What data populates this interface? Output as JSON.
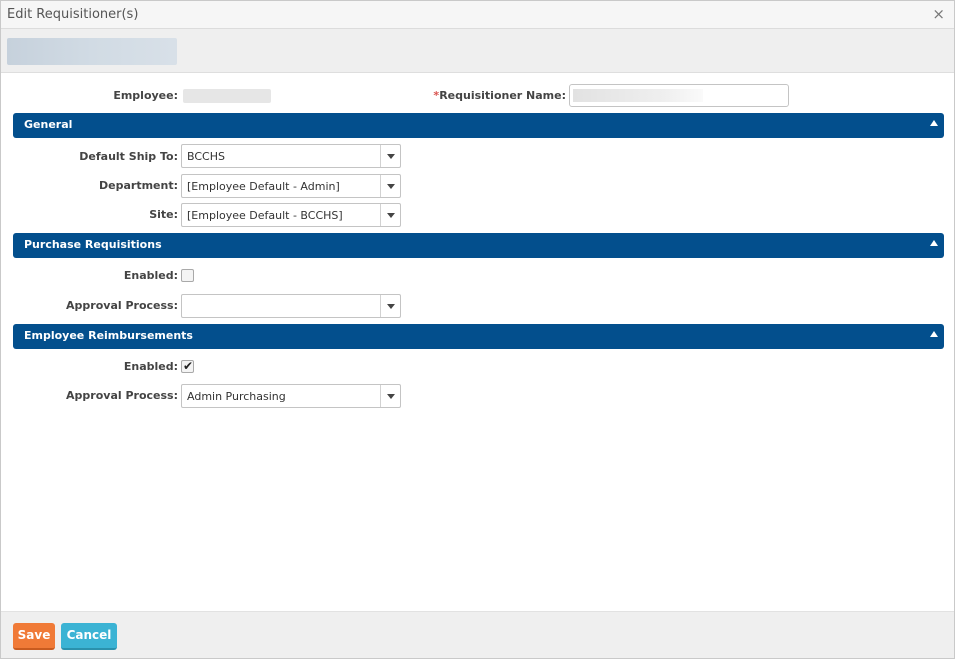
{
  "dialog": {
    "title": "Edit Requisitioner(s)",
    "close_glyph": "×"
  },
  "header": {
    "employee_label": "Employee:",
    "requisitioner_required_mark": "*",
    "requisitioner_label": "Requisitioner Name:"
  },
  "sections": {
    "general": {
      "title": "General",
      "default_ship_to_label": "Default Ship To:",
      "default_ship_to_value": "BCCHS",
      "department_label": "Department:",
      "department_value": "[Employee Default - Admin]",
      "site_label": "Site:",
      "site_value": "[Employee Default - BCCHS]"
    },
    "purchase_requisitions": {
      "title": "Purchase Requisitions",
      "enabled_label": "Enabled:",
      "enabled": false,
      "approval_label": "Approval Process:",
      "approval_value": ""
    },
    "employee_reimbursements": {
      "title": "Employee Reimbursements",
      "enabled_label": "Enabled:",
      "enabled": true,
      "check_glyph": "✔",
      "approval_label": "Approval Process:",
      "approval_value": "Admin Purchasing"
    }
  },
  "footer": {
    "save_label": "Save",
    "cancel_label": "Cancel"
  },
  "colors": {
    "section_header": "#034f8d",
    "save_button": "#f07a37",
    "cancel_button": "#3bb3d4",
    "required": "#d9534f"
  },
  "icons": {
    "close": "close-icon",
    "collapse": "chevron-up-icon",
    "dropdown": "chevron-down-icon",
    "check": "check-icon"
  }
}
